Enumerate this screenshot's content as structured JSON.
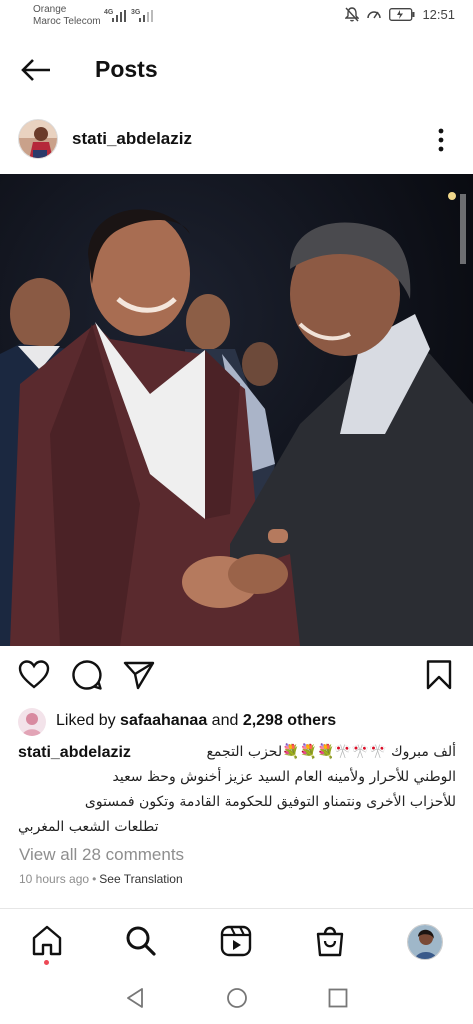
{
  "status": {
    "carrier_line1": "Orange",
    "carrier_line2": "Maroc Telecom",
    "net1": "4G",
    "net2": "3G",
    "time": "12:51",
    "icons": [
      "mute-icon",
      "data-saver-icon",
      "battery-icon"
    ]
  },
  "header": {
    "title": "Posts",
    "back_icon": "arrow-left-icon"
  },
  "post": {
    "username": "stati_abdelaziz",
    "more_icon": "more-vertical-icon",
    "image_alt": "Two men shaking hands at a night event",
    "actions": [
      "heart-icon",
      "comment-icon",
      "share-icon",
      "bookmark-icon"
    ],
    "likes": {
      "prefix": "Liked by ",
      "user": "safaahanaa",
      "middle": " and ",
      "count": "2,298 others"
    },
    "caption": {
      "user": "stati_abdelaziz",
      "line1": "ألف مبروك 🎌🎌🎌💐💐💐لحزب التجمع",
      "line2": "الوطني للأحرار ولأمينه العام السيد عزيز أخنوش وحظ سعيد",
      "line3": "للأحزاب الأخرى ونتمناو التوفيق للحكومة القادمة وتكون فمستوى",
      "line4": "تطلعات الشعب المغربي"
    },
    "comments_link": "View all 28 comments",
    "time_ago": "10 hours ago",
    "separator": "•",
    "translate": "See Translation"
  },
  "nav": {
    "items": [
      "home-icon",
      "search-icon",
      "reels-icon",
      "shop-icon",
      "profile-avatar"
    ]
  },
  "system_nav": [
    "back-triangle-icon",
    "home-circle-icon",
    "recents-square-icon"
  ],
  "colors": {
    "text": "#111111",
    "muted": "#8e8e8e",
    "notification": "#ed4956"
  }
}
